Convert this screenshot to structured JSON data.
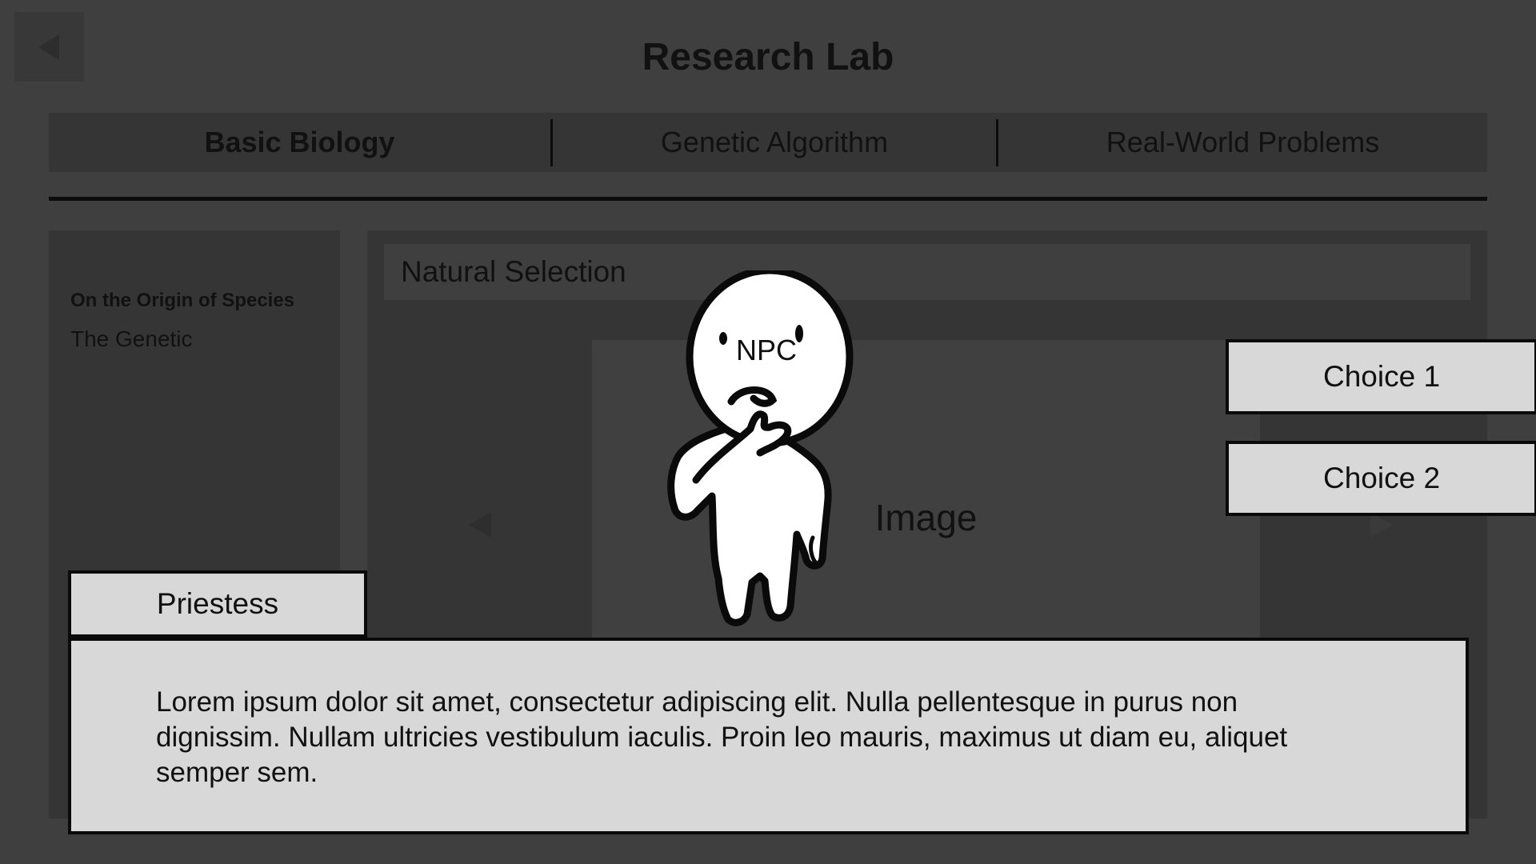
{
  "header": {
    "title": "Research Lab",
    "back_icon": "back-arrow-icon"
  },
  "tabs": [
    {
      "label": "Basic Biology",
      "active": true
    },
    {
      "label": "Genetic Algorithm",
      "active": false
    },
    {
      "label": "Real-World Problems",
      "active": false
    }
  ],
  "sidebar": {
    "items": [
      {
        "label": "On the Origin of Species"
      },
      {
        "label": "The Genetic"
      }
    ]
  },
  "content": {
    "section_title": "Natural Selection",
    "image_label": "Image",
    "prev_icon": "left-arrow-icon",
    "next_icon": "right-arrow-icon"
  },
  "npc": {
    "label": "NPC",
    "icon": "thinking-character-icon"
  },
  "choices": [
    {
      "label": "Choice 1"
    },
    {
      "label": "Choice 2"
    }
  ],
  "dialogue": {
    "speaker": "Priestess",
    "text": "Lorem ipsum dolor sit amet, consectetur adipiscing elit. Nulla pellentesque in purus non dignissim. Nullam ultricies vestibulum iaculis. Proin leo mauris, maximus ut diam eu, aliquet semper sem."
  },
  "colors": {
    "background": "#3f3f3f",
    "panel": "#353535",
    "box": "#d8d8d8",
    "border": "#0a0a0a"
  }
}
